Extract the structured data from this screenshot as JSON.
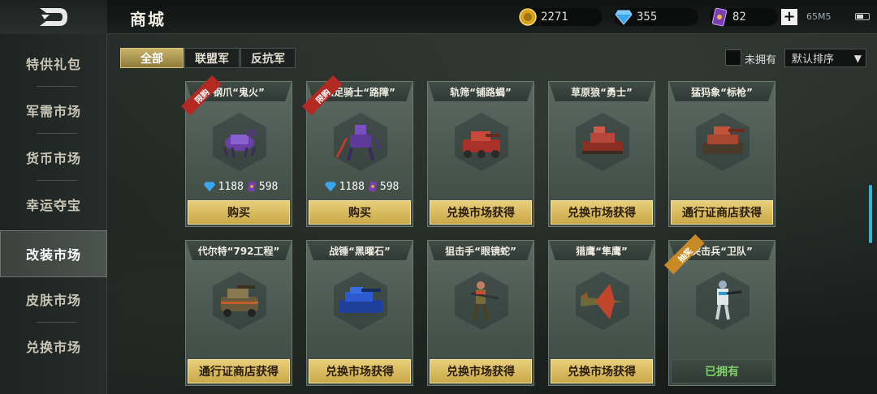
{
  "header": {
    "title": "商城",
    "gold": "2271",
    "gems": "355",
    "cards": "82",
    "plus_label": "+",
    "status_text": "65M5"
  },
  "sidebar": {
    "items": [
      {
        "label": "特供礼包",
        "active": false
      },
      {
        "label": "军需市场",
        "active": false
      },
      {
        "label": "货币市场",
        "active": false
      },
      {
        "label": "幸运夺宝",
        "active": false
      },
      {
        "label": "改装市场",
        "active": true
      },
      {
        "label": "皮肤市场",
        "active": false
      },
      {
        "label": "兑换市场",
        "active": false
      }
    ]
  },
  "filters": {
    "tabs": [
      "全部",
      "联盟军",
      "反抗军"
    ],
    "active_tab": "全部",
    "owned_label": "未拥有",
    "sort_value": "默认排序"
  },
  "colors": {
    "accent_gold": "#e8cf7a",
    "discount_red": "#b22a22",
    "special_gold": "#c98a25",
    "owned_green": "#7fd06a"
  },
  "items": [
    {
      "name": "钢爪“鬼火”",
      "badge": "限购",
      "badge_color": "red",
      "price_gems": "1188",
      "price_cards": "598",
      "button": "购买",
      "icon": "purple-mech-dog-icon"
    },
    {
      "name": "四足骑士“路障”",
      "badge": "限购",
      "badge_color": "red",
      "price_gems": "1188",
      "price_cards": "598",
      "button": "购买",
      "icon": "purple-mech-robot-icon"
    },
    {
      "name": "轨筛“铺路蝎”",
      "badge": "",
      "button": "兑换市场获得",
      "icon": "red-tank-icon"
    },
    {
      "name": "草原狼“勇士”",
      "badge": "",
      "button": "兑换市场获得",
      "icon": "red-tank-icon"
    },
    {
      "name": "猛犸象“标枪”",
      "badge": "",
      "button": "通行证商店获得",
      "icon": "heavy-tank-icon"
    },
    {
      "name": "代尔特“792工程”",
      "badge": "",
      "button": "通行证商店获得",
      "icon": "armored-car-icon"
    },
    {
      "name": "战锤“黑曜石”",
      "badge": "",
      "button": "兑换市场获得",
      "icon": "blue-tank-icon"
    },
    {
      "name": "狙击手“眼镜蛇”",
      "badge": "",
      "button": "兑换市场获得",
      "icon": "sniper-soldier-icon"
    },
    {
      "name": "猎鹰“隼鹰”",
      "badge": "",
      "button": "兑换市场获得",
      "icon": "fighter-jet-icon"
    },
    {
      "name": "突击兵“卫队”",
      "badge": "抽奖",
      "badge_color": "gold",
      "button": "已拥有",
      "icon": "assault-soldier-icon",
      "owned": true
    }
  ]
}
